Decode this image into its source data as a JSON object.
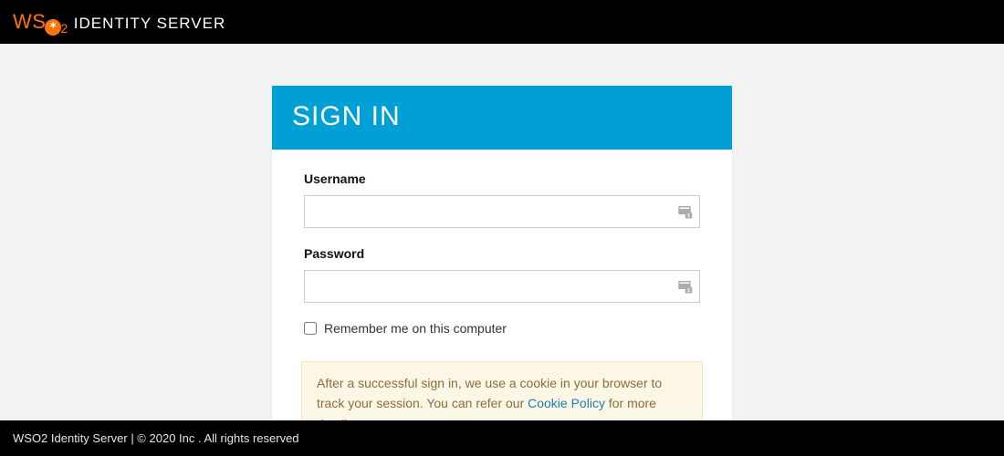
{
  "brand": {
    "ws": "WS",
    "sub2": "2",
    "product": "IDENTITY SERVER"
  },
  "card": {
    "title": "SIGN IN",
    "username_label": "Username",
    "password_label": "Password",
    "remember_label": "Remember me on this computer",
    "notice_pre": "After a successful sign in, we use a cookie in your browser to track your session. You can refer our ",
    "notice_link": "Cookie Policy",
    "notice_post": " for more details."
  },
  "footer": {
    "text": "WSO2 Identity Server | © 2020 Inc . All rights reserved"
  }
}
